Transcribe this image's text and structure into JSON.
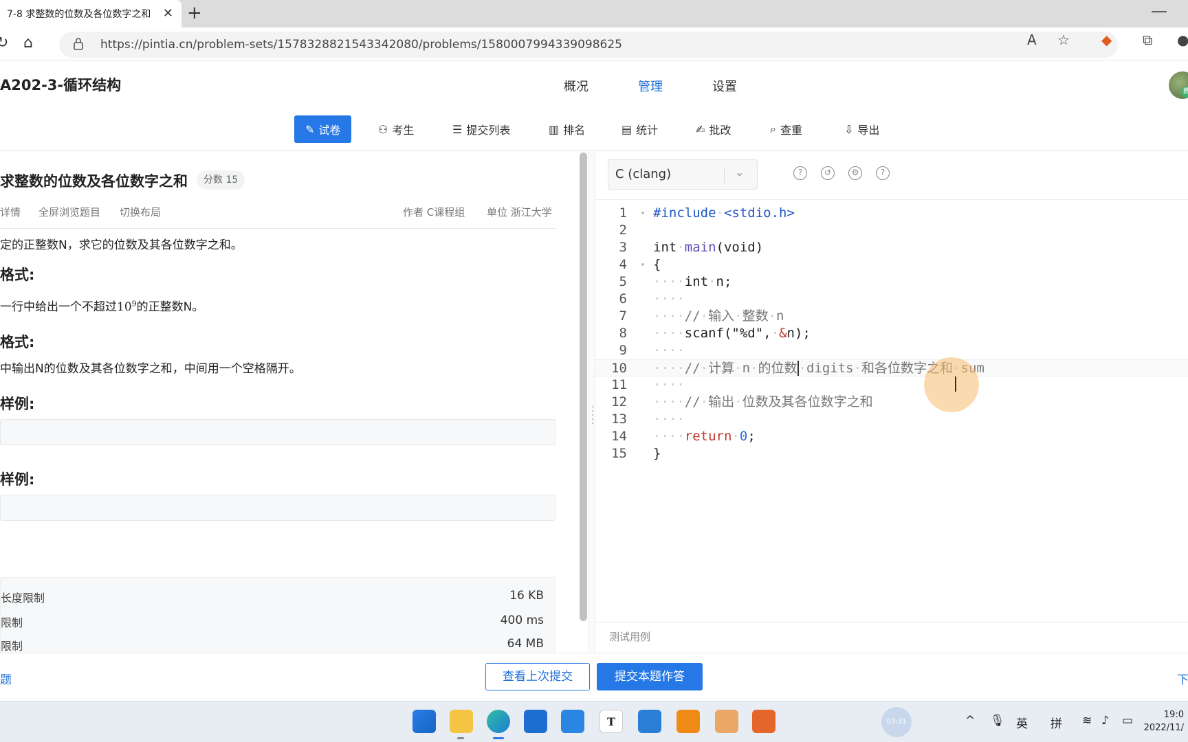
{
  "browser": {
    "tab_title": "7-8 求整数的位数及各位数字之和",
    "url": "https://pintia.cn/problem-sets/1578328821543342080/problems/1580007994339098625"
  },
  "header": {
    "title": "A202-3-循环结构",
    "nav": [
      "概况",
      "管理",
      "设置"
    ],
    "active_nav": "管理"
  },
  "subnav": {
    "items": [
      "试卷",
      "考生",
      "提交列表",
      "排名",
      "统计",
      "批改",
      "查重",
      "导出"
    ]
  },
  "problem": {
    "title": "求整数的位数及各位数字之和",
    "score": "分数 15",
    "links": [
      "题目详情",
      "全屏浏览题目",
      "切换布局"
    ],
    "author": "作者 C课程组",
    "unit": "单位 浙江大学",
    "desc": "定的正整数N，求它的位数及其各位数字之和。",
    "input_head": "格式:",
    "input_text_pre": "一行中给出一个不超过",
    "input_text_base": "10",
    "input_text_exp": "9",
    "input_text_post": "的正整数N。",
    "output_head": "格式:",
    "output_text": "中输出N的位数及其各位数字之和，中间用一个空格隔开。",
    "sample_in_head": "样例:",
    "sample_out_head": "样例:",
    "limits": [
      {
        "label": "长度限制",
        "value": "16 KB"
      },
      {
        "label": "限制",
        "value": "400 ms"
      },
      {
        "label": "限制",
        "value": "64 MB"
      }
    ]
  },
  "editor": {
    "language": "C (clang)",
    "line_numbers": [
      "1",
      "2",
      "3",
      "4",
      "5",
      "6",
      "7",
      "8",
      "9",
      "10",
      "11",
      "12",
      "13",
      "14",
      "15"
    ],
    "testcase_label": "测试用例"
  },
  "footer": {
    "prev": "题",
    "view_last": "查看上次提交",
    "submit": "提交本题作答",
    "next": "下"
  },
  "taskbar": {
    "lang1": "英",
    "lang2": "拼",
    "time": "19:0",
    "date": "2022/11/"
  }
}
